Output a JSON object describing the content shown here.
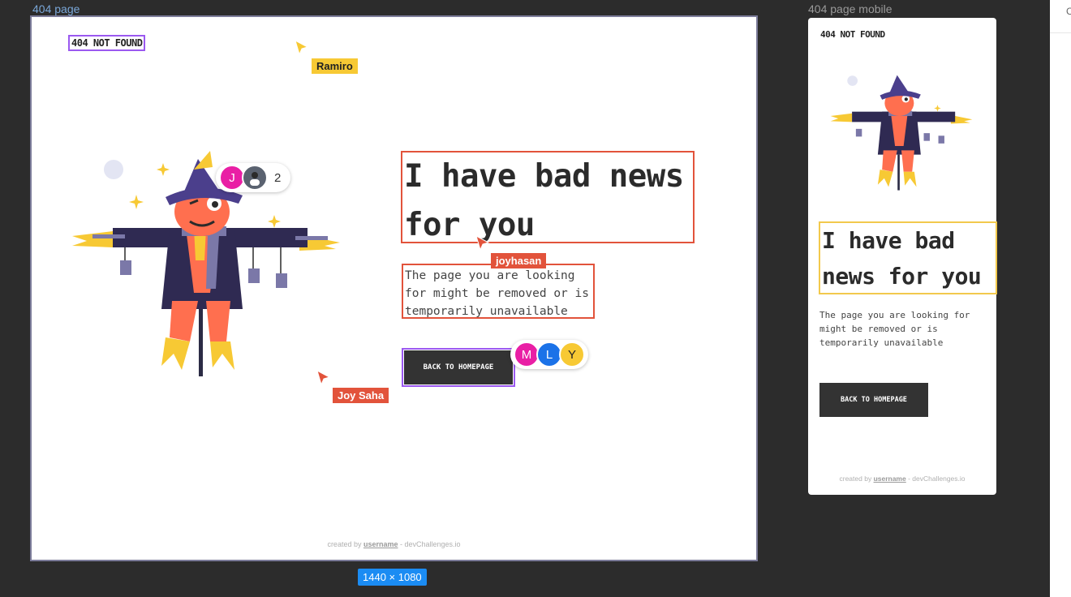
{
  "canvas": {
    "desktop_frame_label": "404 page",
    "mobile_frame_label": "404 page mobile",
    "frame_dimensions": "1440 × 1080"
  },
  "desktop": {
    "logo": "404 NOT FOUND",
    "headline": "I have bad news for you",
    "description": "The page you are looking for might be removed or is temporarily unavailable",
    "button": "BACK TO HOMEPAGE",
    "footer": {
      "prefix": "created by ",
      "username": "username",
      "suffix": " - devChallenges.io"
    }
  },
  "mobile": {
    "logo": "404 NOT FOUND",
    "headline": "I have bad news for you",
    "description": "The page you are looking for might be removed or is temporarily unavailable",
    "button": "BACK TO HOMEPAGE",
    "footer": {
      "prefix": "created by ",
      "username": "username",
      "suffix": " - devChallenges.io"
    }
  },
  "collaborators": {
    "cursors": [
      {
        "name": "Ramiro",
        "color": "#f7c934",
        "text_color": "#222222"
      },
      {
        "name": "joyhasan",
        "color": "#e2533b",
        "text_color": "#ffffff"
      },
      {
        "name": "Joy Saha",
        "color": "#e2533b",
        "text_color": "#ffffff"
      }
    ],
    "group_one": {
      "initial": "J",
      "extra_count": "2"
    },
    "group_two": [
      "M",
      "L",
      "Y"
    ]
  },
  "colors": {
    "selection_purple": "#9b59f0",
    "selection_red": "#e2533b",
    "selection_yellow": "#f2c94c",
    "button_bg": "#333333"
  },
  "icons": [
    "cursor-arrow-icon",
    "scarecrow-illustration"
  ]
}
